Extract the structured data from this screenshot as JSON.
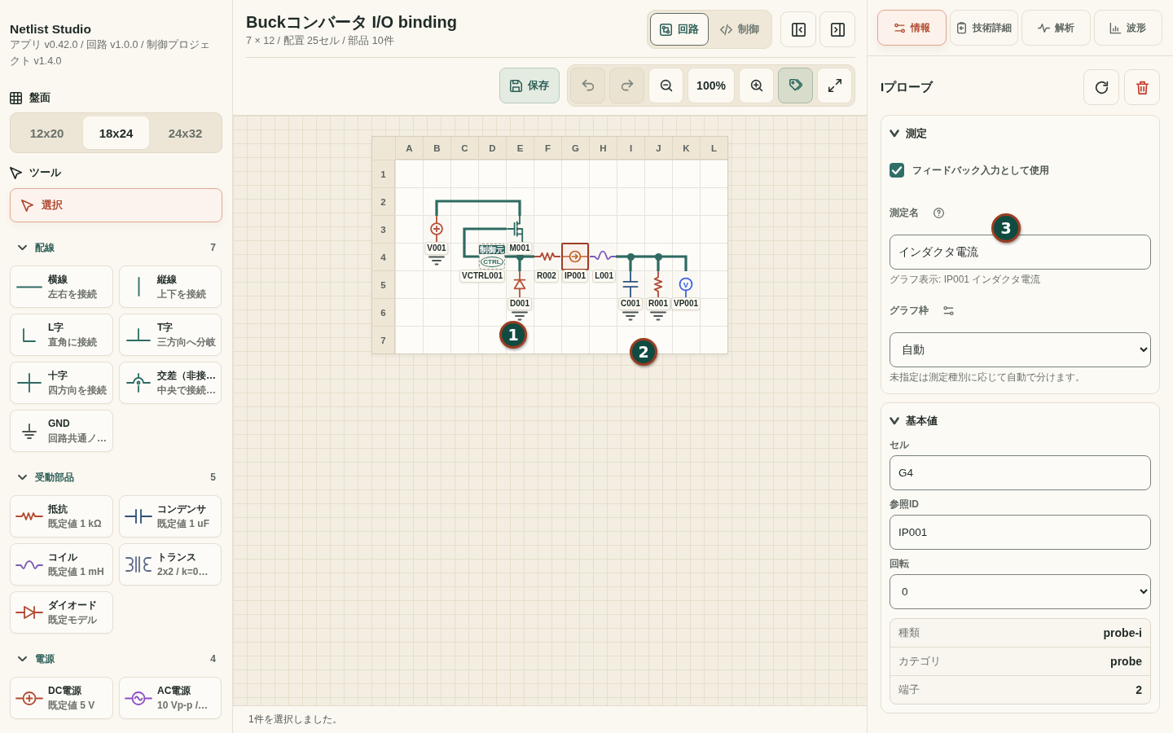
{
  "sidebar": {
    "app_title": "Netlist Studio",
    "version_info": "アプリ v0.42.0 / 回路 v1.0.0 / 制御プロジェクト v1.4.0",
    "board_size": {
      "title": "盤面",
      "options": [
        {
          "label": "12x20",
          "selected": false
        },
        {
          "label": "18x24",
          "selected": true
        },
        {
          "label": "24x32",
          "selected": false
        }
      ]
    },
    "tools": {
      "title": "ツール",
      "items": [
        {
          "label": "選択",
          "selected": true
        }
      ]
    },
    "palette_groups": [
      {
        "title": "配線",
        "count": "7",
        "expanded": true,
        "items": [
          {
            "kind": "wire_h",
            "name": "横線",
            "description": "左右を接続"
          },
          {
            "kind": "wire_v",
            "name": "縦線",
            "description": "上下を接続"
          },
          {
            "kind": "wire_l",
            "name": "L字",
            "description": "直角に接続"
          },
          {
            "kind": "wire_t",
            "name": "T字",
            "description": "三方向へ分岐"
          },
          {
            "kind": "wire_cross",
            "name": "十字",
            "description": "四方向を接続"
          },
          {
            "kind": "wire_hop",
            "name": "交差（非接…",
            "description": "中央で接続…"
          },
          {
            "kind": "ground",
            "name": "GND",
            "description": "回路共通ノ…"
          }
        ]
      },
      {
        "title": "受動部品",
        "count": "5",
        "expanded": true,
        "items": [
          {
            "kind": "resistor",
            "name": "抵抗",
            "description": "既定値 1 kΩ"
          },
          {
            "kind": "capacitor",
            "name": "コンデンサ",
            "description": "既定値 1 uF"
          },
          {
            "kind": "inductor",
            "name": "コイル",
            "description": "既定値 1 mH"
          },
          {
            "kind": "transformer",
            "name": "トランス",
            "description": "2x2 / k=0…"
          },
          {
            "kind": "diode",
            "name": "ダイオード",
            "description": "既定モデル"
          }
        ]
      },
      {
        "title": "電源",
        "count": "4",
        "expanded": true,
        "items": [
          {
            "kind": "dc_source",
            "name": "DC電源",
            "description": "既定値 5 V"
          },
          {
            "kind": "ac_source",
            "name": "AC電源",
            "description": "10 Vp-p /…"
          }
        ]
      }
    ]
  },
  "editor": {
    "title": "Buckコンバータ I/O binding",
    "summary": "7 × 12 / 配置 25セル / 部品 10件",
    "view_tabs": [
      {
        "label": "回路",
        "kind": "circuit",
        "selected": true
      },
      {
        "label": "制御",
        "kind": "code",
        "selected": false
      }
    ],
    "save_button": "保存",
    "toolbar": [
      {
        "kind": "undo",
        "disabled": true,
        "on": false
      },
      {
        "kind": "redo",
        "disabled": true,
        "on": false
      },
      {
        "kind": "zoom_out",
        "disabled": false,
        "on": false
      },
      {
        "kind": "zoom_level",
        "text": "100%",
        "disabled": false,
        "on": false
      },
      {
        "kind": "zoom_in",
        "disabled": false,
        "on": false
      },
      {
        "kind": "labels",
        "disabled": false,
        "on": true
      },
      {
        "kind": "fullscreen",
        "disabled": false,
        "on": false
      }
    ],
    "board": {
      "columns": [
        "A",
        "B",
        "C",
        "D",
        "E",
        "F",
        "G",
        "H",
        "I",
        "J",
        "K",
        "L"
      ],
      "rows": [
        {
          "label": "1",
          "cells": [
            null,
            null,
            null,
            null,
            null,
            null,
            null,
            null,
            null,
            null,
            null,
            null
          ]
        },
        {
          "label": "2",
          "cells": [
            null,
            {
              "kind": "wire_es"
            },
            {
              "kind": "wire_ew"
            },
            {
              "kind": "wire_ew"
            },
            {
              "kind": "wire_sw"
            },
            null,
            null,
            null,
            null,
            null,
            null,
            null
          ]
        },
        {
          "label": "3",
          "cells": [
            null,
            {
              "kind": "dc_source",
              "ref": "V001",
              "vertical": true,
              "selected": false
            },
            {
              "kind": "wire_es"
            },
            {
              "kind": "wire_ew"
            },
            {
              "kind": "mosfet",
              "ref": "M001",
              "vertical": false,
              "selected": false
            },
            null,
            null,
            null,
            null,
            null,
            null,
            null
          ]
        },
        {
          "label": "4",
          "cells": [
            null,
            {
              "kind": "ground"
            },
            {
              "kind": "wire_ne"
            },
            {
              "kind": "control_source",
              "ref": "VCTRL001",
              "vertical": false,
              "selected": false,
              "badge": "制御元",
              "symbol_text": "CTRL"
            },
            {
              "kind": "wire_nesw"
            },
            {
              "kind": "resistor",
              "ref": "R002",
              "vertical": false,
              "selected": false
            },
            {
              "kind": "current_probe",
              "ref": "IP001",
              "vertical": false,
              "selected": true
            },
            {
              "kind": "inductor",
              "ref": "L001",
              "vertical": false,
              "selected": false
            },
            {
              "kind": "wire_esw"
            },
            {
              "kind": "wire_esw"
            },
            {
              "kind": "wire_sw"
            },
            null
          ]
        },
        {
          "label": "5",
          "cells": [
            null,
            null,
            null,
            null,
            {
              "kind": "diode",
              "ref": "D001",
              "vertical": true,
              "selected": false
            },
            null,
            null,
            null,
            {
              "kind": "capacitor",
              "ref": "C001",
              "vertical": true,
              "selected": false
            },
            {
              "kind": "resistor",
              "ref": "R001",
              "vertical": true,
              "selected": false
            },
            {
              "kind": "voltage_probe",
              "ref": "VP001",
              "vertical": true,
              "selected": false,
              "symbol_text": "V"
            },
            null
          ]
        },
        {
          "label": "6",
          "cells": [
            null,
            null,
            null,
            null,
            {
              "kind": "ground"
            },
            null,
            null,
            null,
            {
              "kind": "ground"
            },
            {
              "kind": "ground"
            },
            null,
            null
          ]
        },
        {
          "label": "7",
          "cells": [
            null,
            null,
            null,
            null,
            null,
            null,
            null,
            null,
            null,
            null,
            null,
            null
          ]
        }
      ]
    },
    "markers": [
      {
        "label": "1"
      },
      {
        "label": "2"
      }
    ],
    "status": "1件を選択しました。"
  },
  "inspector": {
    "tabs": [
      {
        "label": "情報",
        "kind": "info",
        "selected": true
      },
      {
        "label": "技術詳細",
        "kind": "spec",
        "selected": false
      },
      {
        "label": "解析",
        "kind": "analysis",
        "selected": false
      },
      {
        "label": "波形",
        "kind": "waveform",
        "selected": false
      }
    ],
    "title": "Iプローブ",
    "measurement": {
      "title": "測定",
      "expanded": true,
      "marker": "3",
      "feedback": {
        "label": "フィードバック入力として使用",
        "checked": true
      },
      "name_field": {
        "label": "測定名",
        "value": "インダクタ電流",
        "help_text": "グラフ表示: IP001 インダクタ電流"
      },
      "graph_field": {
        "label": "グラフ枠",
        "value": "自動",
        "help_text": "未指定は測定種別に応じて自動で分けます。"
      }
    },
    "basic_values": {
      "title": "基本値",
      "expanded": true,
      "fields": [
        {
          "label": "セル",
          "kind": "text",
          "value": "G4"
        },
        {
          "label": "参照ID",
          "kind": "text",
          "value": "IP001"
        },
        {
          "label": "回転",
          "kind": "select",
          "value": "0"
        }
      ],
      "properties": [
        {
          "name": "種類",
          "value": "probe-i"
        },
        {
          "name": "カテゴリ",
          "value": "probe"
        },
        {
          "name": "端子",
          "value": "2"
        }
      ]
    }
  }
}
